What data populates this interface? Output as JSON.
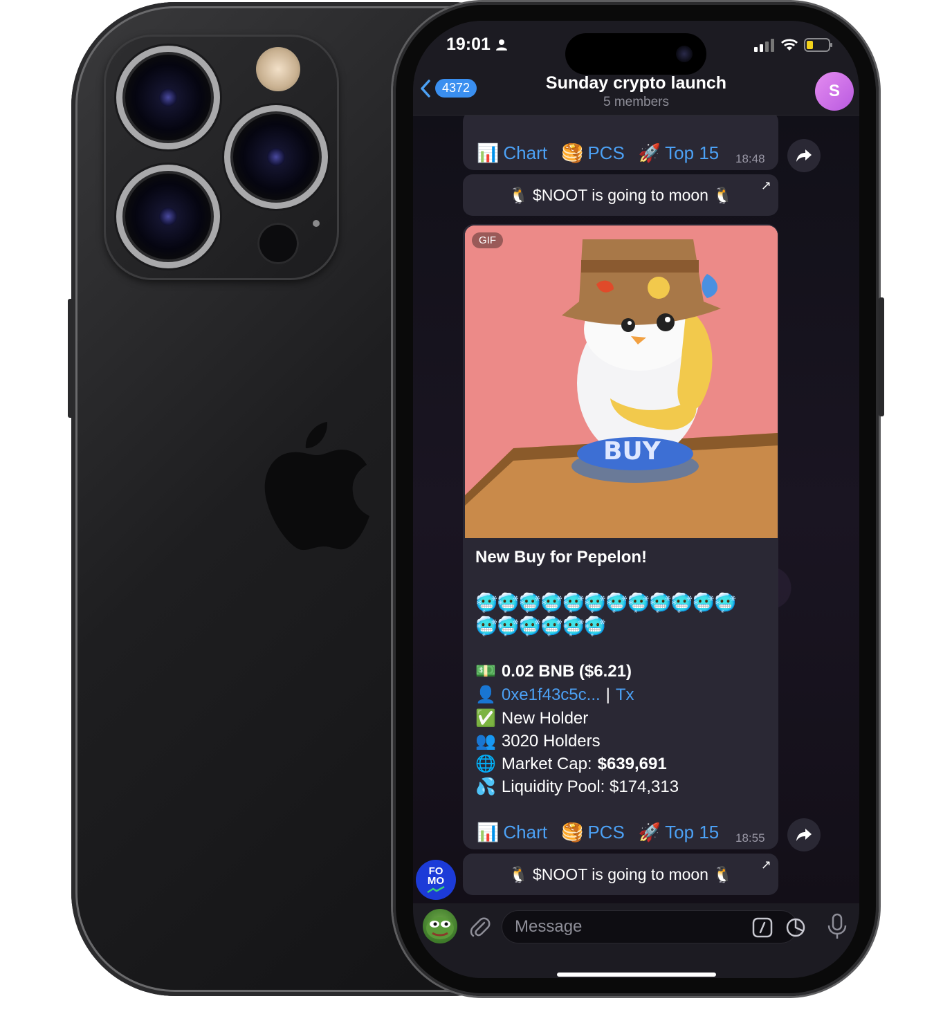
{
  "status": {
    "time": "19:01"
  },
  "header": {
    "unread_count": "4372",
    "title": "Sunday crypto launch",
    "subtitle": "5 members",
    "avatar_letter": "S"
  },
  "msg1": {
    "buttons": [
      {
        "emoji": "📊",
        "label": "Chart"
      },
      {
        "emoji": "🥞",
        "label": "PCS"
      },
      {
        "emoji": "🚀",
        "label": "Top 15"
      }
    ],
    "time": "18:48",
    "inline_button": "🐧 $NOOT is going to moon 🐧"
  },
  "msg2": {
    "gif_label": "GIF",
    "gif_button_text": "BUY",
    "title": "New Buy for Pepelon!",
    "emoji_row1": "🥶🥶🥶🥶🥶🥶🥶🥶🥶🥶🥶🥶",
    "emoji_row2": "🥶🥶🥶🥶🥶🥶",
    "amount_emoji": "💵",
    "amount": "0.02 BNB ($6.21)",
    "wallet_emoji": "👤",
    "wallet": "0xe1f43c5c...",
    "separator": "|",
    "tx": "Tx",
    "new_holder_emoji": "✅",
    "new_holder": "New Holder",
    "holders_emoji": "👥",
    "holders": "3020 Holders",
    "mcap_emoji": "🌐",
    "mcap_label": "Market Cap:",
    "mcap_value": "$639,691",
    "liq_emoji": "💦",
    "liquidity": "Liquidity Pool: $174,313",
    "buttons": [
      {
        "emoji": "📊",
        "label": "Chart"
      },
      {
        "emoji": "🥞",
        "label": "PCS"
      },
      {
        "emoji": "🚀",
        "label": "Top 15"
      }
    ],
    "time": "18:55",
    "inline_button": "🐧 $NOOT is going to moon 🐧"
  },
  "bot_avatar": {
    "line1": "FO",
    "line2": "MO"
  },
  "composer": {
    "placeholder": "Message"
  },
  "colors": {
    "accent": "#4ca1f5",
    "bubble": "#2a2834",
    "avatar": "#c46ee6"
  }
}
